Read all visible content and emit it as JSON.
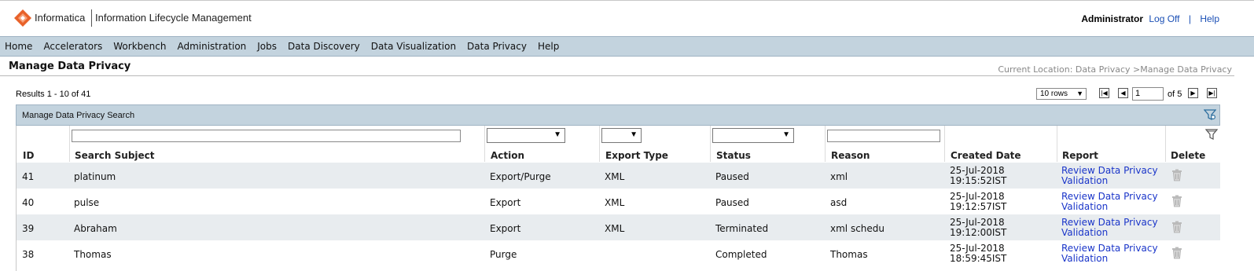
{
  "header": {
    "brand": "Informatica",
    "product": "Information Lifecycle Management",
    "user": "Administrator",
    "logoff": "Log Off",
    "separator": "|",
    "help": "Help"
  },
  "nav": [
    "Home",
    "Accelerators",
    "Workbench",
    "Administration",
    "Jobs",
    "Data Discovery",
    "Data Visualization",
    "Data Privacy",
    "Help"
  ],
  "page": {
    "title": "Manage Data Privacy",
    "breadcrumb": "Current Location: Data Privacy >Manage Data Privacy"
  },
  "pager": {
    "results": "Results 1 - 10 of 41",
    "rows": "10 rows",
    "page": "1",
    "of": "of 5"
  },
  "panel": {
    "title": "Manage Data Privacy Search"
  },
  "columns": {
    "id": "ID",
    "subject": "Search Subject",
    "action": "Action",
    "export_type": "Export Type",
    "status": "Status",
    "reason": "Reason",
    "created": "Created Date",
    "report": "Report",
    "delete": "Delete"
  },
  "rows": [
    {
      "id": "41",
      "subject": "platinum",
      "action": "Export/Purge",
      "export_type": "XML",
      "status": "Paused",
      "reason": "xml",
      "date": "25-Jul-2018",
      "time": "19:15:52IST",
      "report1": "Review Data Privacy",
      "report2": "Validation"
    },
    {
      "id": "40",
      "subject": "pulse",
      "action": "Export",
      "export_type": "XML",
      "status": "Paused",
      "reason": "asd",
      "date": "25-Jul-2018",
      "time": "19:12:57IST",
      "report1": "Review Data Privacy",
      "report2": "Validation"
    },
    {
      "id": "39",
      "subject": "Abraham",
      "action": "Export",
      "export_type": "XML",
      "status": "Terminated",
      "reason": "xml schedu",
      "date": "25-Jul-2018",
      "time": "19:12:00IST",
      "report1": "Review Data Privacy",
      "report2": "Validation"
    },
    {
      "id": "38",
      "subject": "Thomas",
      "action": "Purge",
      "export_type": "",
      "status": "Completed",
      "reason": "Thomas",
      "date": "25-Jul-2018",
      "time": "18:59:45IST",
      "report1": "Review Data Privacy",
      "report2": "Validation"
    }
  ],
  "icons": {
    "logo": "informatica-logo",
    "trash": "trash-icon",
    "filter": "filter-icon"
  },
  "colors": {
    "nav_bg": "#c3d3de",
    "link": "#1a35c9",
    "logo": "#e8622a"
  }
}
